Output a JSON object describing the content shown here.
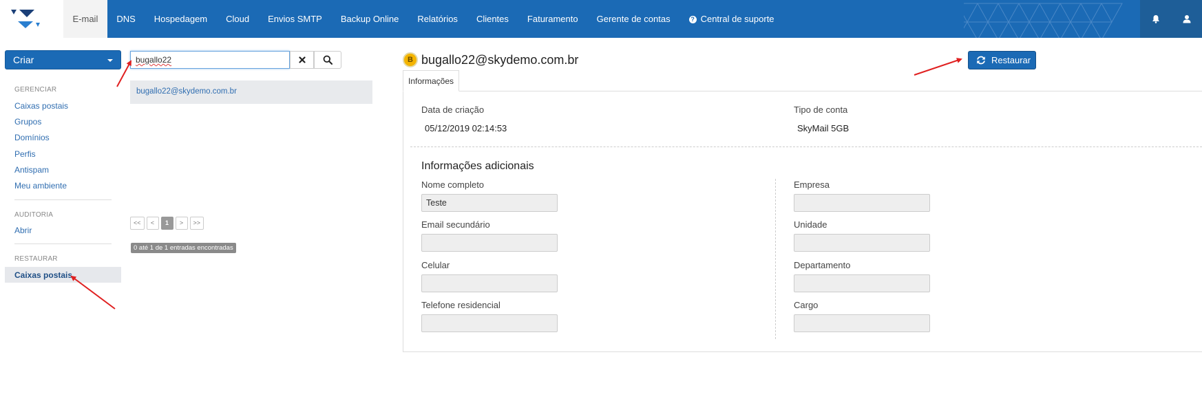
{
  "nav": {
    "items": [
      "E-mail",
      "DNS",
      "Hospedagem",
      "Cloud",
      "Envios SMTP",
      "Backup Online",
      "Relatórios",
      "Clientes",
      "Faturamento",
      "Gerente de contas"
    ],
    "support": "Central de suporte",
    "active": "E-mail"
  },
  "sidebar": {
    "criar": "Criar",
    "sections": [
      {
        "title": "GERENCIAR",
        "items": [
          "Caixas postais",
          "Grupos",
          "Domínios",
          "Perfis",
          "Antispam",
          "Meu ambiente"
        ]
      },
      {
        "title": "AUDITORIA",
        "items": [
          "Abrir"
        ]
      },
      {
        "title": "RESTAURAR",
        "items": [
          "Caixas postais"
        ]
      }
    ],
    "active_item": "Caixas postais"
  },
  "search": {
    "value": "bugallo22",
    "results": [
      "bugallo22@skydemo.com.br"
    ],
    "pager": [
      "<<",
      "<",
      "1",
      ">",
      ">>"
    ],
    "count_text": "0 até 1 de 1 entradas encontradas"
  },
  "detail": {
    "avatar_letter": "B",
    "title": "bugallo22@skydemo.com.br",
    "tab": "Informações",
    "restore_button": "Restaurar",
    "creation_label": "Data de criação",
    "creation_value": "05/12/2019 02:14:53",
    "account_type_label": "Tipo de conta",
    "account_type_value": "SkyMail 5GB",
    "additional_title": "Informações adicionais",
    "fields_left": [
      {
        "label": "Nome completo",
        "value": "Teste"
      },
      {
        "label": "Email secundário",
        "value": ""
      },
      {
        "label": "Celular",
        "value": ""
      },
      {
        "label": "Telefone residencial",
        "value": ""
      }
    ],
    "fields_right": [
      {
        "label": "Empresa",
        "value": ""
      },
      {
        "label": "Unidade",
        "value": ""
      },
      {
        "label": "Departamento",
        "value": ""
      },
      {
        "label": "Cargo",
        "value": ""
      }
    ]
  },
  "colors": {
    "primary": "#1b6ab5",
    "annotation_arrow": "#e02020"
  },
  "icons": [
    "logo-icon",
    "bell-icon",
    "user-icon",
    "help-icon",
    "caret-down-icon",
    "close-icon",
    "search-icon",
    "refresh-icon"
  ]
}
